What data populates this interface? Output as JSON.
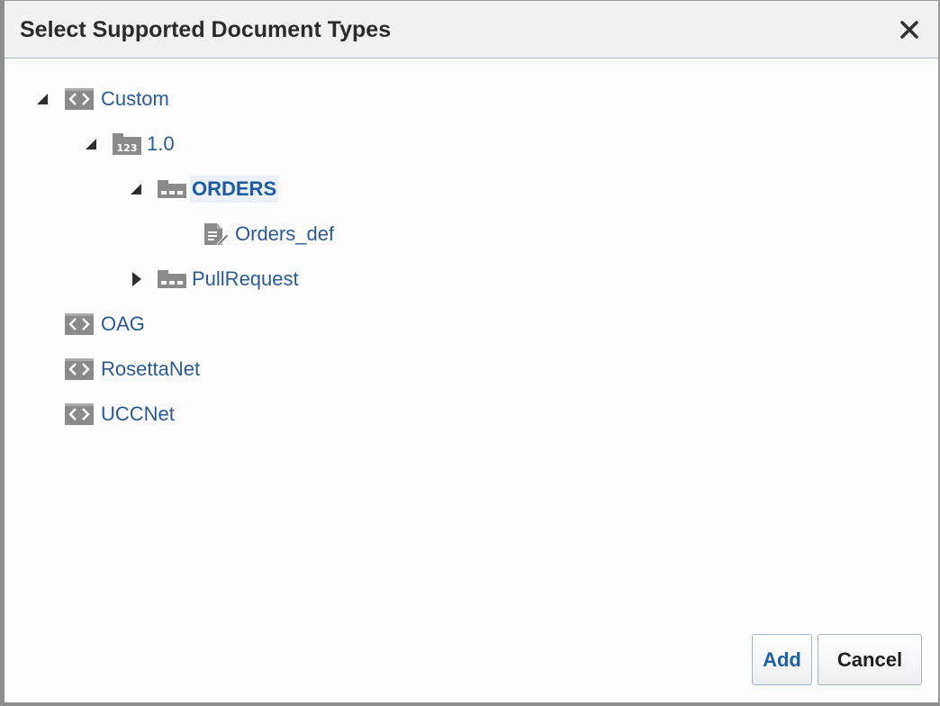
{
  "dialog": {
    "title": "Select Supported Document Types",
    "close_icon": "close-icon"
  },
  "tree": {
    "custom": {
      "label": "Custom",
      "icon": "document-protocol-icon",
      "expanded": true
    },
    "version": {
      "label": "1.0",
      "icon": "version-icon",
      "expanded": true
    },
    "orders": {
      "label": "ORDERS",
      "icon": "document-type-icon",
      "expanded": true,
      "selected": true
    },
    "orders_def": {
      "label": "Orders_def",
      "icon": "document-definition-icon"
    },
    "pullrequest": {
      "label": "PullRequest",
      "icon": "document-type-icon",
      "expanded": false
    },
    "oag": {
      "label": "OAG",
      "icon": "document-protocol-icon"
    },
    "rosettanet": {
      "label": "RosettaNet",
      "icon": "document-protocol-icon"
    },
    "uccnet": {
      "label": "UCCNet",
      "icon": "document-protocol-icon"
    }
  },
  "buttons": {
    "add_label": "Add",
    "cancel_label": "Cancel"
  },
  "colors": {
    "link": "#2a5b96",
    "title": "#2b2b2b",
    "icon": "#8a8a8a"
  }
}
